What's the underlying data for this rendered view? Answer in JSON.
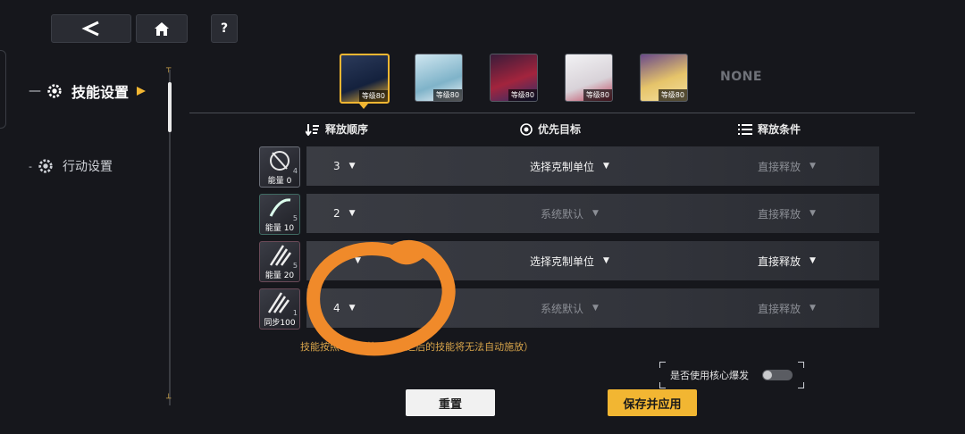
{
  "top_nav": {
    "back_icon": "chevron-left-icon",
    "home_icon": "home-icon",
    "help_label": "?"
  },
  "sidebar": {
    "items": [
      {
        "label": "技能设置",
        "active": true
      },
      {
        "label": "行动设置",
        "active": false
      }
    ]
  },
  "team": {
    "portraits": [
      {
        "level_label": "等级80",
        "selected": true
      },
      {
        "level_label": "等级80",
        "selected": false
      },
      {
        "level_label": "等级80",
        "selected": false
      },
      {
        "level_label": "等级80",
        "selected": false
      },
      {
        "level_label": "等级80",
        "selected": false
      }
    ],
    "empty_slot_label": "NONE"
  },
  "columns": {
    "order": "释放顺序",
    "target": "优先目标",
    "condition": "释放条件"
  },
  "skills": [
    {
      "cost_label": "能量 0",
      "corner_num": "4",
      "order": "3",
      "target": "选择克制单位",
      "target_active": true,
      "condition": "直接释放",
      "condition_active": false
    },
    {
      "cost_label": "能量 10",
      "corner_num": "5",
      "order": "2",
      "target": "系统默认",
      "target_active": false,
      "condition": "直接释放",
      "condition_active": false
    },
    {
      "cost_label": "能量 20",
      "corner_num": "5",
      "order": "",
      "target": "选择克制单位",
      "target_active": true,
      "condition": "直接释放",
      "condition_active": true
    },
    {
      "cost_label": "同步100",
      "corner_num": "1",
      "order": "4",
      "target": "系统默认",
      "target_active": false,
      "condition": "直接释放",
      "condition_active": false
    }
  ],
  "hint_text": "技能按照1(                     )释放（普攻之后的技能将无法自动施放）",
  "core_burst": {
    "label": "是否使用核心爆发",
    "enabled": false
  },
  "buttons": {
    "reset": "重置",
    "save": "保存并应用"
  },
  "colors": {
    "accent": "#f2b632",
    "annotation": "#f08a2a"
  }
}
